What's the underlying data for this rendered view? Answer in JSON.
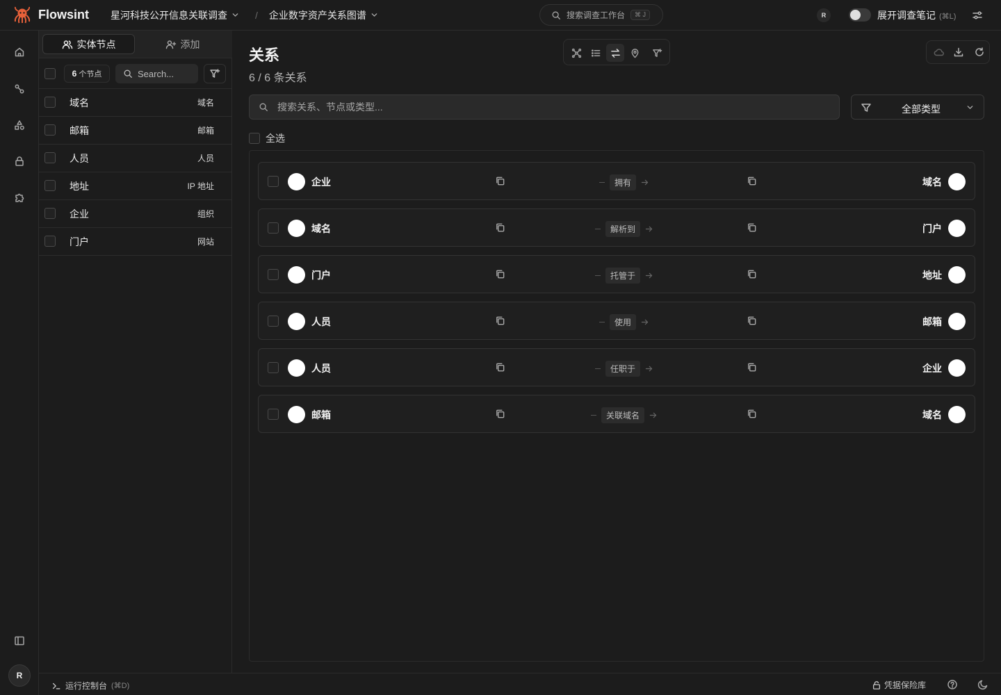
{
  "app": {
    "name": "Flowsint"
  },
  "header": {
    "investigation": "星河科技公开信息关联调查",
    "graph": "企业数字资产关系图谱",
    "separator": "/",
    "command_search": {
      "placeholder": "搜索调查工作台",
      "shortcut": "⌘ J"
    },
    "user_initial": "R",
    "notes_toggle": {
      "label": "展开调查笔记",
      "shortcut": "(⌘L)",
      "on": false
    }
  },
  "rail": {
    "icons": [
      "home-icon",
      "graph-icon",
      "shapes-icon",
      "lock-icon",
      "puzzle-icon",
      "sidebar-toggle-icon"
    ],
    "user_initial": "R"
  },
  "entity_panel": {
    "tabs": [
      {
        "label": "实体节点",
        "active": true
      },
      {
        "label": "添加",
        "active": false
      }
    ],
    "count_number": "6",
    "count_unit": "个节点",
    "search_placeholder": "Search...",
    "nodes": [
      {
        "name": "域名",
        "type": "域名"
      },
      {
        "name": "邮箱",
        "type": "邮箱"
      },
      {
        "name": "人员",
        "type": "人员"
      },
      {
        "name": "地址",
        "type": "IP 地址"
      },
      {
        "name": "企业",
        "type": "组织"
      },
      {
        "name": "门户",
        "type": "网站"
      }
    ]
  },
  "main": {
    "title": "关系",
    "subtitle": "6 / 6 条关系",
    "search_placeholder": "搜索关系、节点或类型...",
    "type_filter": "全部类型",
    "select_all": "全选",
    "relations": [
      {
        "source": "企业",
        "label": "拥有",
        "target": "域名"
      },
      {
        "source": "域名",
        "label": "解析到",
        "target": "门户"
      },
      {
        "source": "门户",
        "label": "托管于",
        "target": "地址"
      },
      {
        "source": "人员",
        "label": "使用",
        "target": "邮箱"
      },
      {
        "source": "人员",
        "label": "任职于",
        "target": "企业"
      },
      {
        "source": "邮箱",
        "label": "关联域名",
        "target": "域名"
      }
    ]
  },
  "footer": {
    "console_label": "运行控制台",
    "console_shortcut": "(⌘D)",
    "vault_label": "凭据保险库"
  }
}
